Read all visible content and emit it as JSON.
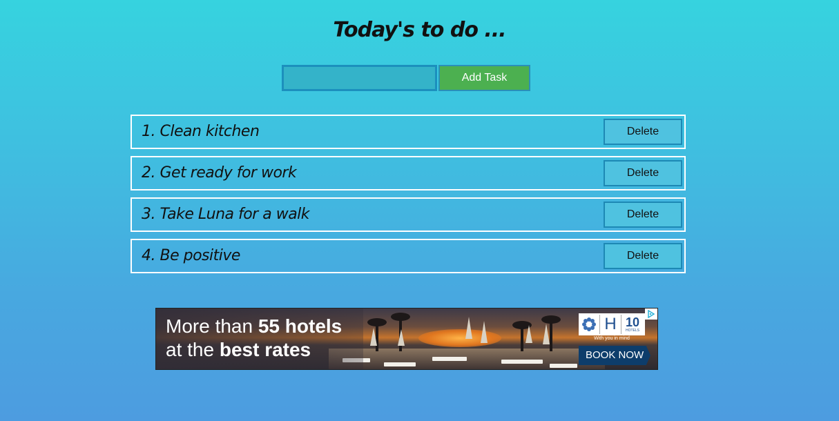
{
  "header": {
    "title": "Today's to do ..."
  },
  "add_form": {
    "input_value": "",
    "input_placeholder": "",
    "add_button_label": "Add Task"
  },
  "tasks": [
    {
      "text": "1. Clean kitchen",
      "delete_label": "Delete"
    },
    {
      "text": "2. Get ready for work",
      "delete_label": "Delete"
    },
    {
      "text": "3. Take Luna for a walk",
      "delete_label": "Delete"
    },
    {
      "text": "4. Be positive",
      "delete_label": "Delete"
    }
  ],
  "ad": {
    "line1_prefix": "More than ",
    "line1_bold": "55 hotels",
    "line2_prefix": "at the ",
    "line2_bold": "best rates",
    "logo_h": "H",
    "logo_number": "10",
    "logo_sub": "HOTELS",
    "tagline": "With you in mind",
    "cta_label": "BOOK NOW",
    "adchoices_icon": "adchoices-icon"
  },
  "colors": {
    "background_top": "#36d3df",
    "background_bottom": "#4d9ce0",
    "add_button": "#4cb050",
    "delete_button": "#4fc2e0",
    "task_border": "#ffffff",
    "ad_cta": "#0d3d6b"
  }
}
